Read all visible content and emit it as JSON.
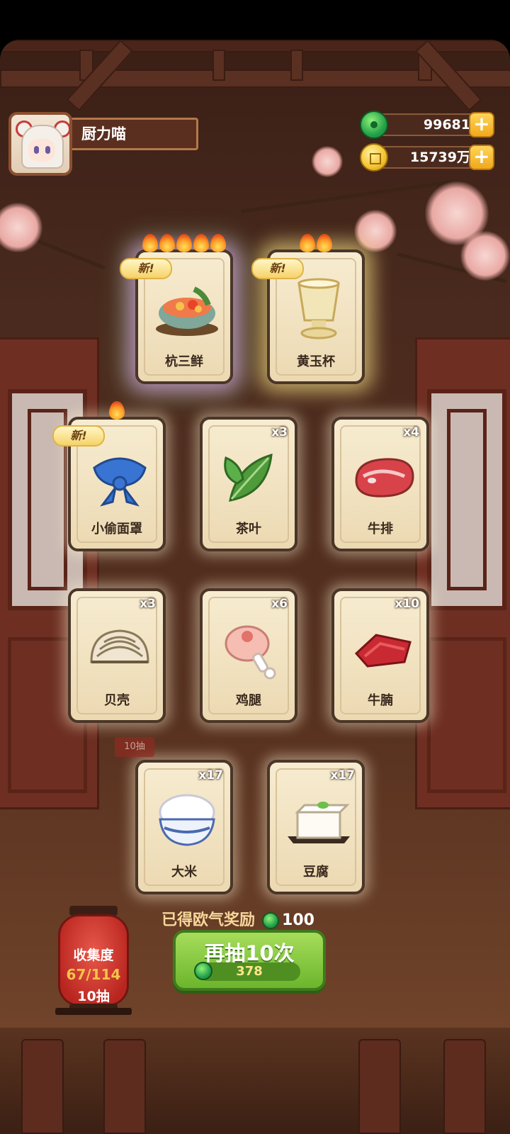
{
  "player": {
    "name": "厨力喵"
  },
  "currency": {
    "jade": "99681",
    "coins": "15739万",
    "plus": "+"
  },
  "cards": [
    {
      "name": "杭三鲜",
      "qty": "",
      "new": "新!",
      "flames": 5,
      "glow": "rainbow",
      "icon": "seafood-pot-icon"
    },
    {
      "name": "黄玉杯",
      "qty": "",
      "new": "新!",
      "flames": 2,
      "glow": "gold",
      "icon": "jade-cup-icon"
    },
    {
      "name": "小偷面罩",
      "qty": "",
      "new": "新!",
      "flames": 1,
      "glow": "none",
      "icon": "thief-mask-icon"
    },
    {
      "name": "茶叶",
      "qty": "x3",
      "new": "",
      "flames": 0,
      "glow": "none",
      "icon": "tea-leaf-icon"
    },
    {
      "name": "牛排",
      "qty": "x4",
      "new": "",
      "flames": 0,
      "glow": "none",
      "icon": "steak-icon"
    },
    {
      "name": "贝壳",
      "qty": "x3",
      "new": "",
      "flames": 0,
      "glow": "none",
      "icon": "clam-icon"
    },
    {
      "name": "鸡腿",
      "qty": "x6",
      "new": "",
      "flames": 0,
      "glow": "none",
      "icon": "chicken-leg-icon"
    },
    {
      "name": "牛腩",
      "qty": "x10",
      "new": "",
      "flames": 0,
      "glow": "none",
      "icon": "beef-brisket-icon"
    },
    {
      "name": "大米",
      "qty": "x17",
      "new": "",
      "flames": 0,
      "glow": "none",
      "icon": "rice-bowl-icon"
    },
    {
      "name": "豆腐",
      "qty": "x17",
      "new": "",
      "flames": 0,
      "glow": "none",
      "icon": "tofu-icon"
    }
  ],
  "reward": {
    "label": "已得欧气奖励",
    "amount": "100"
  },
  "draw_button": {
    "label": "再抽10次",
    "cost": "378"
  },
  "collection": {
    "title": "收集度",
    "progress": "67/114",
    "draws": "10抽"
  },
  "background_tag": "10抽",
  "colors": {
    "jade": "#26a24a",
    "gold": "#f3c431",
    "button": "#6cb52c",
    "lantern": "#b8251f"
  }
}
